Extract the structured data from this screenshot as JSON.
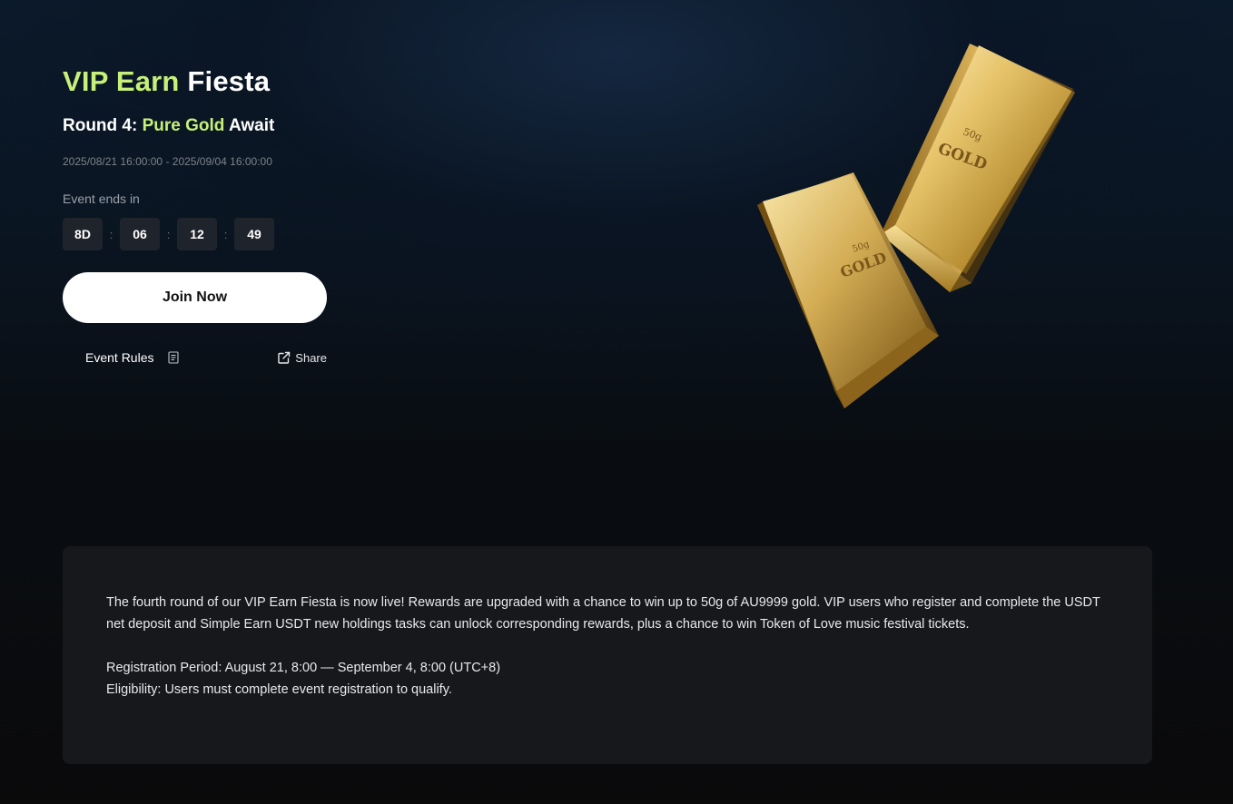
{
  "hero": {
    "title_accent": "VIP Earn",
    "title_rest": "Fiesta",
    "subtitle_prefix": "Round 4:",
    "subtitle_accent": "Pure Gold",
    "subtitle_suffix": "Await",
    "date_range": "2025/08/21 16:00:00 - 2025/09/04 16:00:00",
    "ends_label": "Event ends in",
    "countdown": {
      "days": "8D",
      "hours": "06",
      "minutes": "12",
      "seconds": "49",
      "separator": ":"
    },
    "join_label": "Join Now",
    "rules_label": "Event Rules",
    "share_label": "Share",
    "image": {
      "icon": "gold-bars-image",
      "bar_text": "GOLD",
      "bar_weight": "50g"
    }
  },
  "description": {
    "paragraph": "The fourth round of our VIP Earn Fiesta is now live! Rewards are upgraded with a chance to win up to 50g of AU9999 gold. VIP users who register and complete the USDT net deposit and Simple Earn USDT new holdings tasks can unlock corresponding rewards, plus a chance to win Token of Love music festival tickets.",
    "registration": "Registration Period: August 21, 8:00 — September 4, 8:00 (UTC+8)",
    "eligibility": "Eligibility: Users must complete event registration to qualify."
  },
  "colors": {
    "accent": "#c6f07a",
    "card_bg": "#17181b",
    "countdown_bg": "#1f232b",
    "button_bg": "#ffffff"
  }
}
